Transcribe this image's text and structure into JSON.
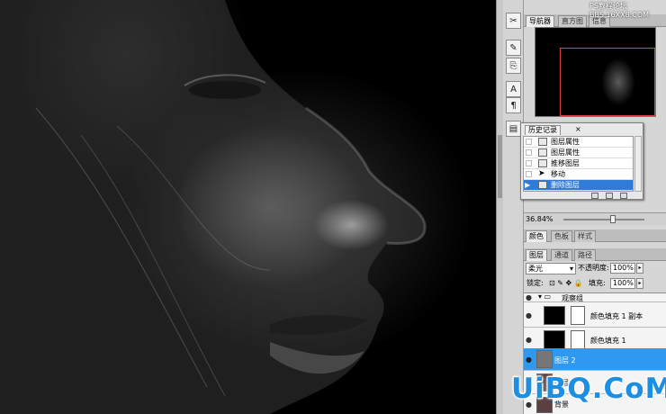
{
  "navigator": {
    "tabs": [
      {
        "label": "导航器",
        "active": true
      },
      {
        "label": "直方图",
        "active": false
      },
      {
        "label": "信息",
        "active": false
      }
    ],
    "zoom": "36.84%"
  },
  "watermark_top": {
    "line1": "PS教程论坛",
    "line2": "BBS.16XX8.COM"
  },
  "history": {
    "tab_label": "历史记录",
    "items": [
      {
        "label": "图层属性",
        "selected": false
      },
      {
        "label": "图层属性",
        "selected": false
      },
      {
        "label": "推移图层",
        "selected": false
      },
      {
        "label": "移动",
        "selected": false
      },
      {
        "label": "删除图层",
        "selected": true
      }
    ]
  },
  "color_panel": {
    "tabs": [
      {
        "label": "颜色",
        "active": true
      },
      {
        "label": "色板",
        "active": false
      },
      {
        "label": "样式",
        "active": false
      }
    ]
  },
  "layers_panel": {
    "tabs": [
      {
        "label": "图层",
        "active": true
      },
      {
        "label": "通道",
        "active": false
      },
      {
        "label": "路径",
        "active": false
      }
    ],
    "blend_mode": "柔光",
    "opacity_label": "不透明度:",
    "opacity": "100%",
    "lock_label": "锁定:",
    "fill_label": "填充:",
    "fill": "100%",
    "layers": [
      {
        "name": "观察组",
        "type": "group"
      },
      {
        "name": "颜色填充 1 副本",
        "type": "fill"
      },
      {
        "name": "颜色填充 1",
        "type": "fill"
      },
      {
        "name": "图层 2",
        "type": "pixel",
        "selected": true
      },
      {
        "name": "图层 1",
        "type": "photo"
      },
      {
        "name": "背景",
        "type": "photo"
      }
    ]
  },
  "watermark": "UiBQ.CoM",
  "colors": {
    "selection": "#2f98f0",
    "history_selection": "#2f7bd8",
    "nav_box": "#e0403a",
    "watermark": "#1d8fe0"
  }
}
